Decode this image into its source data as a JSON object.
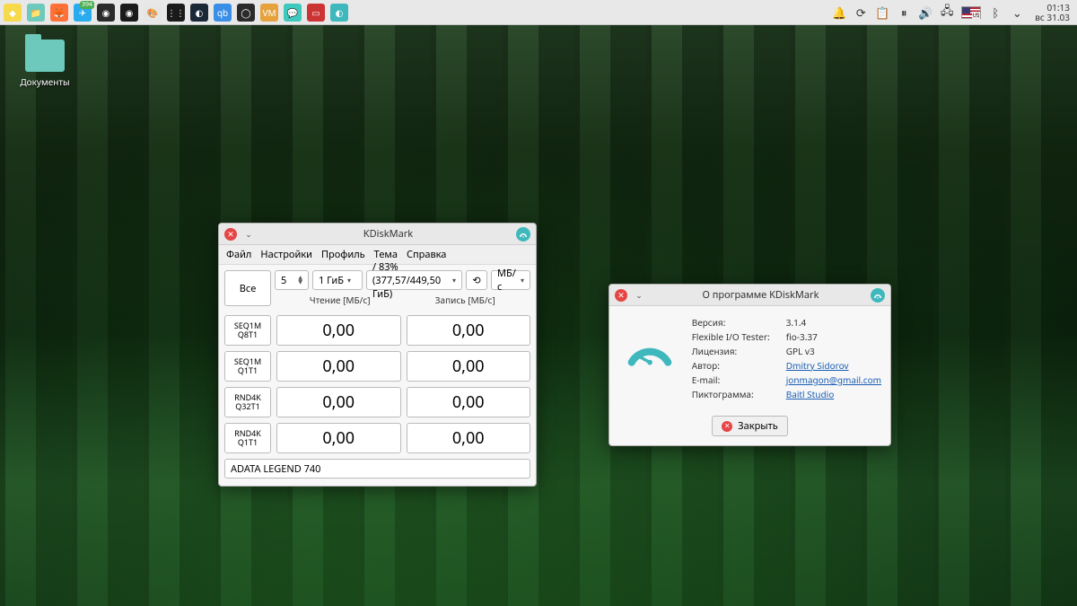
{
  "taskbar": {
    "apps": [
      {
        "name": "start-logo",
        "icon": "◆",
        "bg": "#f7d94c"
      },
      {
        "name": "file-manager",
        "icon": "📁",
        "bg": "#6cc9bb"
      },
      {
        "name": "firefox",
        "icon": "🦊",
        "bg": "#ff7139"
      },
      {
        "name": "telegram",
        "icon": "✈",
        "bg": "#2aabee",
        "badge": "394"
      },
      {
        "name": "obs",
        "icon": "◉",
        "bg": "#2b2b2b"
      },
      {
        "name": "obs-studio",
        "icon": "◉",
        "bg": "#1a1a1a"
      },
      {
        "name": "kolourpaint",
        "icon": "🎨",
        "bg": "#e6e6e6"
      },
      {
        "name": "davinci",
        "icon": "⋮⋮",
        "bg": "#1a1a1a"
      },
      {
        "name": "steam",
        "icon": "◐",
        "bg": "#1b2838"
      },
      {
        "name": "qbittorrent",
        "icon": "qb",
        "bg": "#3a8ee6"
      },
      {
        "name": "app-circle",
        "icon": "◯",
        "bg": "#2b2b2b"
      },
      {
        "name": "virt-manager",
        "icon": "VM",
        "bg": "#e6a23c"
      },
      {
        "name": "chat",
        "icon": "💬",
        "bg": "#3fc9bd"
      },
      {
        "name": "retroarch",
        "icon": "▭",
        "bg": "#cc3333"
      },
      {
        "name": "kdiskmark",
        "icon": "◐",
        "bg": "#3fb8bd"
      }
    ],
    "tray": {
      "notif": "🔔",
      "update": "⟳",
      "clip": "📋",
      "media": "⏸",
      "vol": "🔊",
      "net": "🖧",
      "bt": "ᛒ",
      "expand": "⌄"
    },
    "locale": "US",
    "clock_time": "01:13",
    "clock_date": "вс 31.03"
  },
  "desktop": {
    "documents_label": "Документы"
  },
  "kdiskmark": {
    "title": "KDiskMark",
    "menu": [
      "Файл",
      "Настройки",
      "Профиль",
      "Тема",
      "Справка"
    ],
    "all_btn": "Все",
    "loops": "5",
    "size": "1 ГиБ",
    "target": "/ 83% (377,57/449,50 ГиБ)",
    "unit": "МБ/с",
    "head_read": "Чтение [МБ/с]",
    "head_write": "Запись [МБ/с]",
    "rows": [
      {
        "l1": "SEQ1M",
        "l2": "Q8T1",
        "r": "0,00",
        "w": "0,00"
      },
      {
        "l1": "SEQ1M",
        "l2": "Q1T1",
        "r": "0,00",
        "w": "0,00"
      },
      {
        "l1": "RND4K",
        "l2": "Q32T1",
        "r": "0,00",
        "w": "0,00"
      },
      {
        "l1": "RND4K",
        "l2": "Q1T1",
        "r": "0,00",
        "w": "0,00"
      }
    ],
    "device": "ADATA LEGEND 740"
  },
  "about": {
    "title": "О программе KDiskMark",
    "rows": [
      {
        "k": "Версия:",
        "v": "3.1.4",
        "link": false
      },
      {
        "k": "Flexible I/O Tester:",
        "v": "fio-3.37",
        "link": false
      },
      {
        "k": "Лицензия:",
        "v": "GPL v3",
        "link": false
      },
      {
        "k": "Автор:",
        "v": "Dmitry Sidorov",
        "link": true
      },
      {
        "k": "E-mail:",
        "v": "jonmagon@gmail.com",
        "link": true
      },
      {
        "k": "Пиктограмма:",
        "v": "Baitl Studio",
        "link": true
      }
    ],
    "close": "Закрыть"
  }
}
